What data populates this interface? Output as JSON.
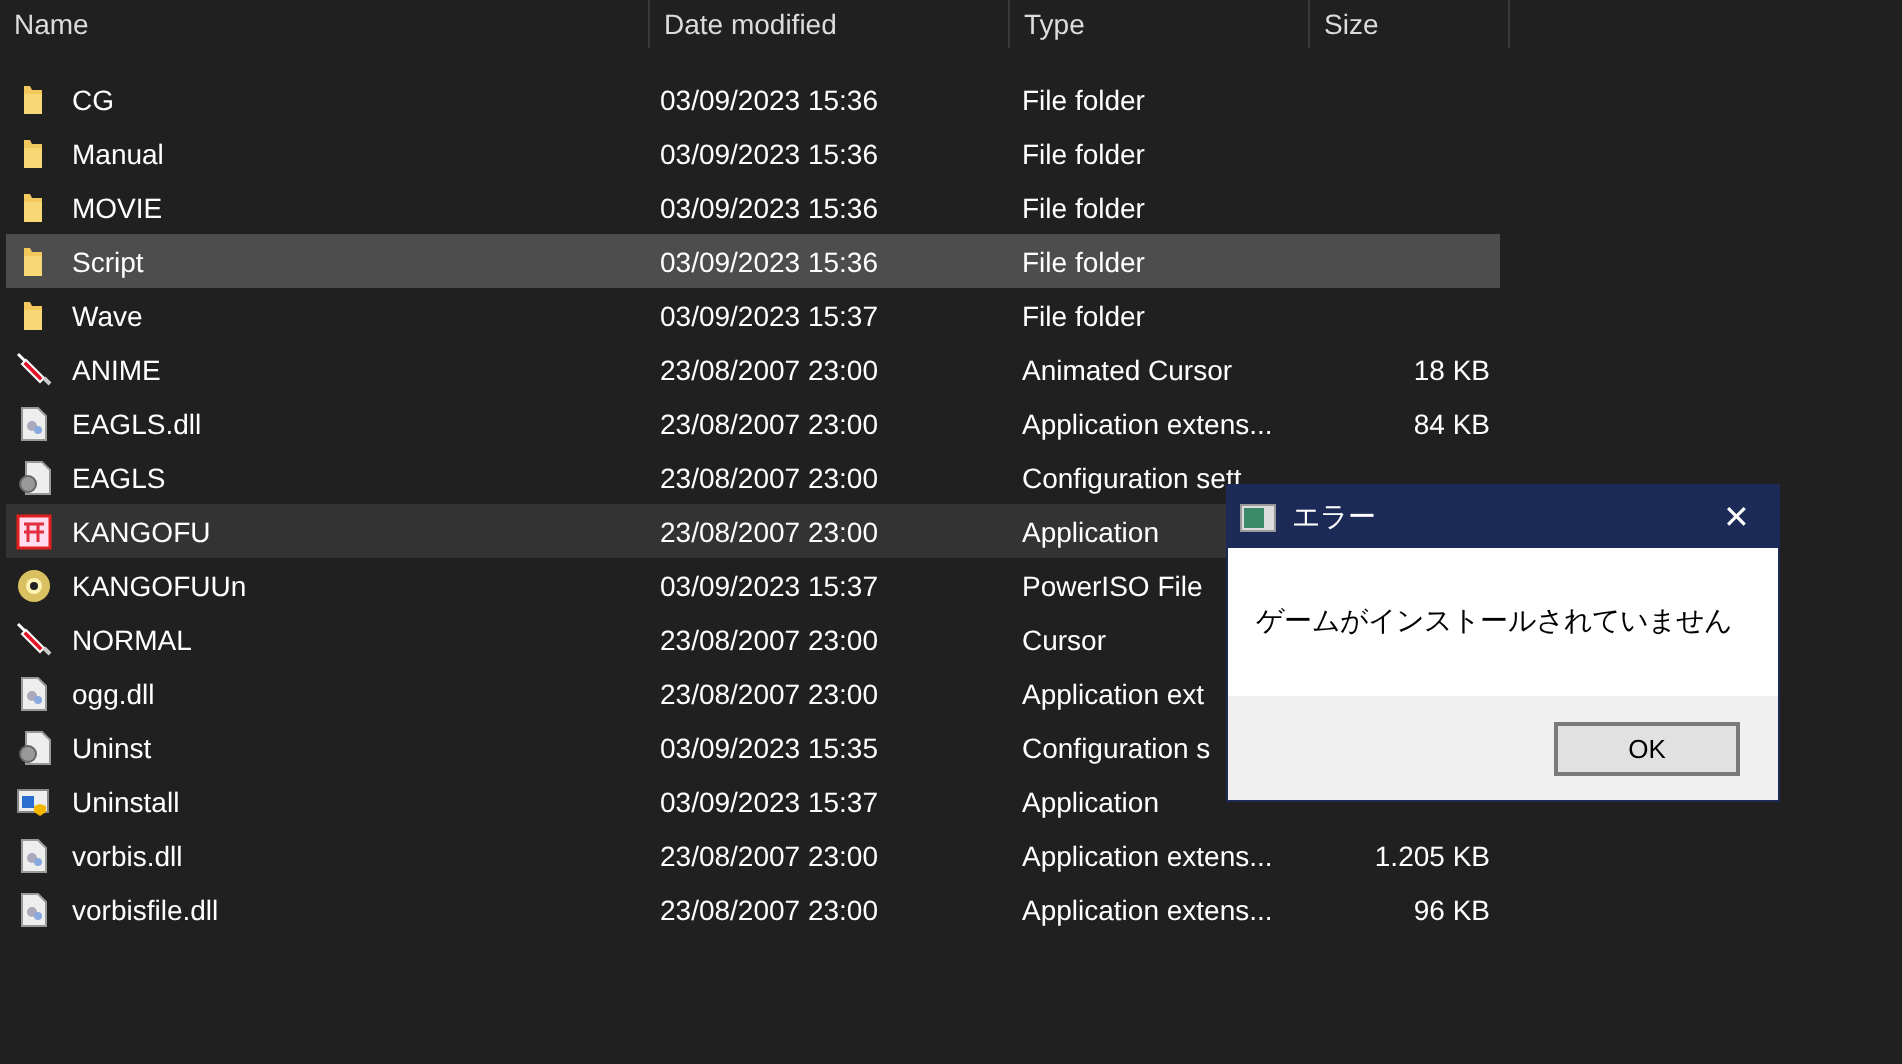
{
  "columns": [
    "Name",
    "Date modified",
    "Type",
    "Size"
  ],
  "files": [
    {
      "kind": "folder",
      "name": "CG",
      "date": "03/09/2023 15:36",
      "type": "File folder",
      "selected": false,
      "hovered": false
    },
    {
      "kind": "folder",
      "name": "Manual",
      "date": "03/09/2023 15:36",
      "type": "File folder",
      "selected": false,
      "hovered": false
    },
    {
      "kind": "folder",
      "name": "MOVIE",
      "date": "03/09/2023 15:36",
      "type": "File folder",
      "selected": false,
      "hovered": false
    },
    {
      "kind": "folder",
      "name": "Script",
      "date": "03/09/2023 15:36",
      "type": "File folder",
      "selected": true,
      "hovered": false
    },
    {
      "kind": "folder",
      "name": "Wave",
      "date": "03/09/2023 15:37",
      "type": "File folder",
      "selected": false,
      "hovered": false
    },
    {
      "kind": "cursor",
      "name": "ANIME",
      "date": "23/08/2007 23:00",
      "type": "Animated Cursor",
      "size": "18 KB",
      "selected": false,
      "hovered": false
    },
    {
      "kind": "dll",
      "name": "EAGLS.dll",
      "date": "23/08/2007 23:00",
      "type": "Application extens...",
      "size": "84 KB",
      "selected": false,
      "hovered": false
    },
    {
      "kind": "config",
      "name": "EAGLS",
      "date": "23/08/2007 23:00",
      "type": "Configuration sett",
      "selected": false,
      "hovered": false
    },
    {
      "kind": "app",
      "name": "KANGOFU",
      "date": "23/08/2007 23:00",
      "type": "Application",
      "selected": false,
      "hovered": true
    },
    {
      "kind": "disc",
      "name": "KANGOFUUn",
      "date": "03/09/2023 15:37",
      "type": "PowerISO File",
      "selected": false,
      "hovered": false
    },
    {
      "kind": "cursor",
      "name": "NORMAL",
      "date": "23/08/2007 23:00",
      "type": "Cursor",
      "selected": false,
      "hovered": false
    },
    {
      "kind": "dll",
      "name": "ogg.dll",
      "date": "23/08/2007 23:00",
      "type": "Application ext",
      "selected": false,
      "hovered": false
    },
    {
      "kind": "config",
      "name": "Uninst",
      "date": "03/09/2023 15:35",
      "type": "Configuration s",
      "selected": false,
      "hovered": false
    },
    {
      "kind": "installer",
      "name": "Uninstall",
      "date": "03/09/2023 15:37",
      "type": "Application",
      "selected": false,
      "hovered": false
    },
    {
      "kind": "dll",
      "name": "vorbis.dll",
      "date": "23/08/2007 23:00",
      "type": "Application extens...",
      "size": "1.205 KB",
      "selected": false,
      "hovered": false
    },
    {
      "kind": "dll",
      "name": "vorbisfile.dll",
      "date": "23/08/2007 23:00",
      "type": "Application extens...",
      "size": "96 KB",
      "selected": false,
      "hovered": false
    }
  ],
  "dialog": {
    "title": "エラー",
    "close": "✕",
    "message": "ゲームがインストールされていません",
    "button": "OK"
  }
}
